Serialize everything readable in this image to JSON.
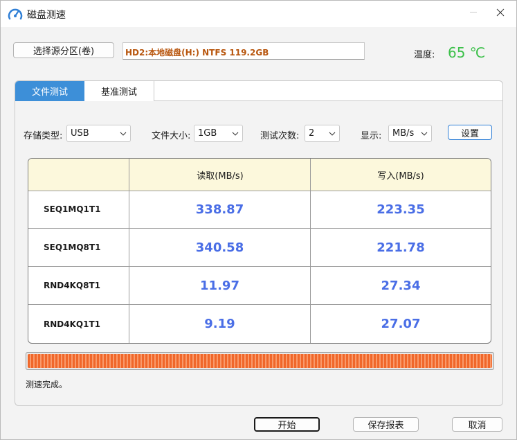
{
  "window": {
    "title": "磁盘测速",
    "accent_color": "#3d8fd8"
  },
  "top": {
    "source_button_label": "选择源分区(卷)",
    "drive_path": "HD2:本地磁盘(H:) NTFS 119.2GB",
    "temperature_label": "温度:",
    "temperature_value": "65 ℃",
    "temperature_color": "#3cc04a"
  },
  "tabs": [
    {
      "label": "文件测试",
      "active": true
    },
    {
      "label": "基准测试",
      "active": false
    }
  ],
  "options": {
    "storage_type_label": "存储类型:",
    "storage_type_value": "USB",
    "file_size_label": "文件大小:",
    "file_size_value": "1GB",
    "test_count_label": "测试次数:",
    "test_count_value": "2",
    "display_label": "显示:",
    "display_value": "MB/s",
    "settings_button_label": "设置"
  },
  "results": {
    "columns": [
      "",
      "读取(MB/s)",
      "写入(MB/s)"
    ],
    "rows": [
      {
        "name": "SEQ1MQ1T1",
        "read": "338.87",
        "write": "223.35"
      },
      {
        "name": "SEQ1MQ8T1",
        "read": "340.58",
        "write": "221.78"
      },
      {
        "name": "RND4KQ8T1",
        "read": "11.97",
        "write": "27.34"
      },
      {
        "name": "RND4KQ1T1",
        "read": "9.19",
        "write": "27.07"
      }
    ],
    "value_color": "#4a6ee6",
    "header_background": "#fcf8dc"
  },
  "progress": {
    "percent": 100,
    "color": "#f0672a"
  },
  "status_text": "测速完成。",
  "footer": {
    "start_label": "开始",
    "save_report_label": "保存报表",
    "cancel_label": "取消"
  },
  "icons": {
    "app": "speedometer-icon",
    "minimize": "minimize-icon",
    "close": "close-icon",
    "dropdown": "chevron-down-icon"
  }
}
